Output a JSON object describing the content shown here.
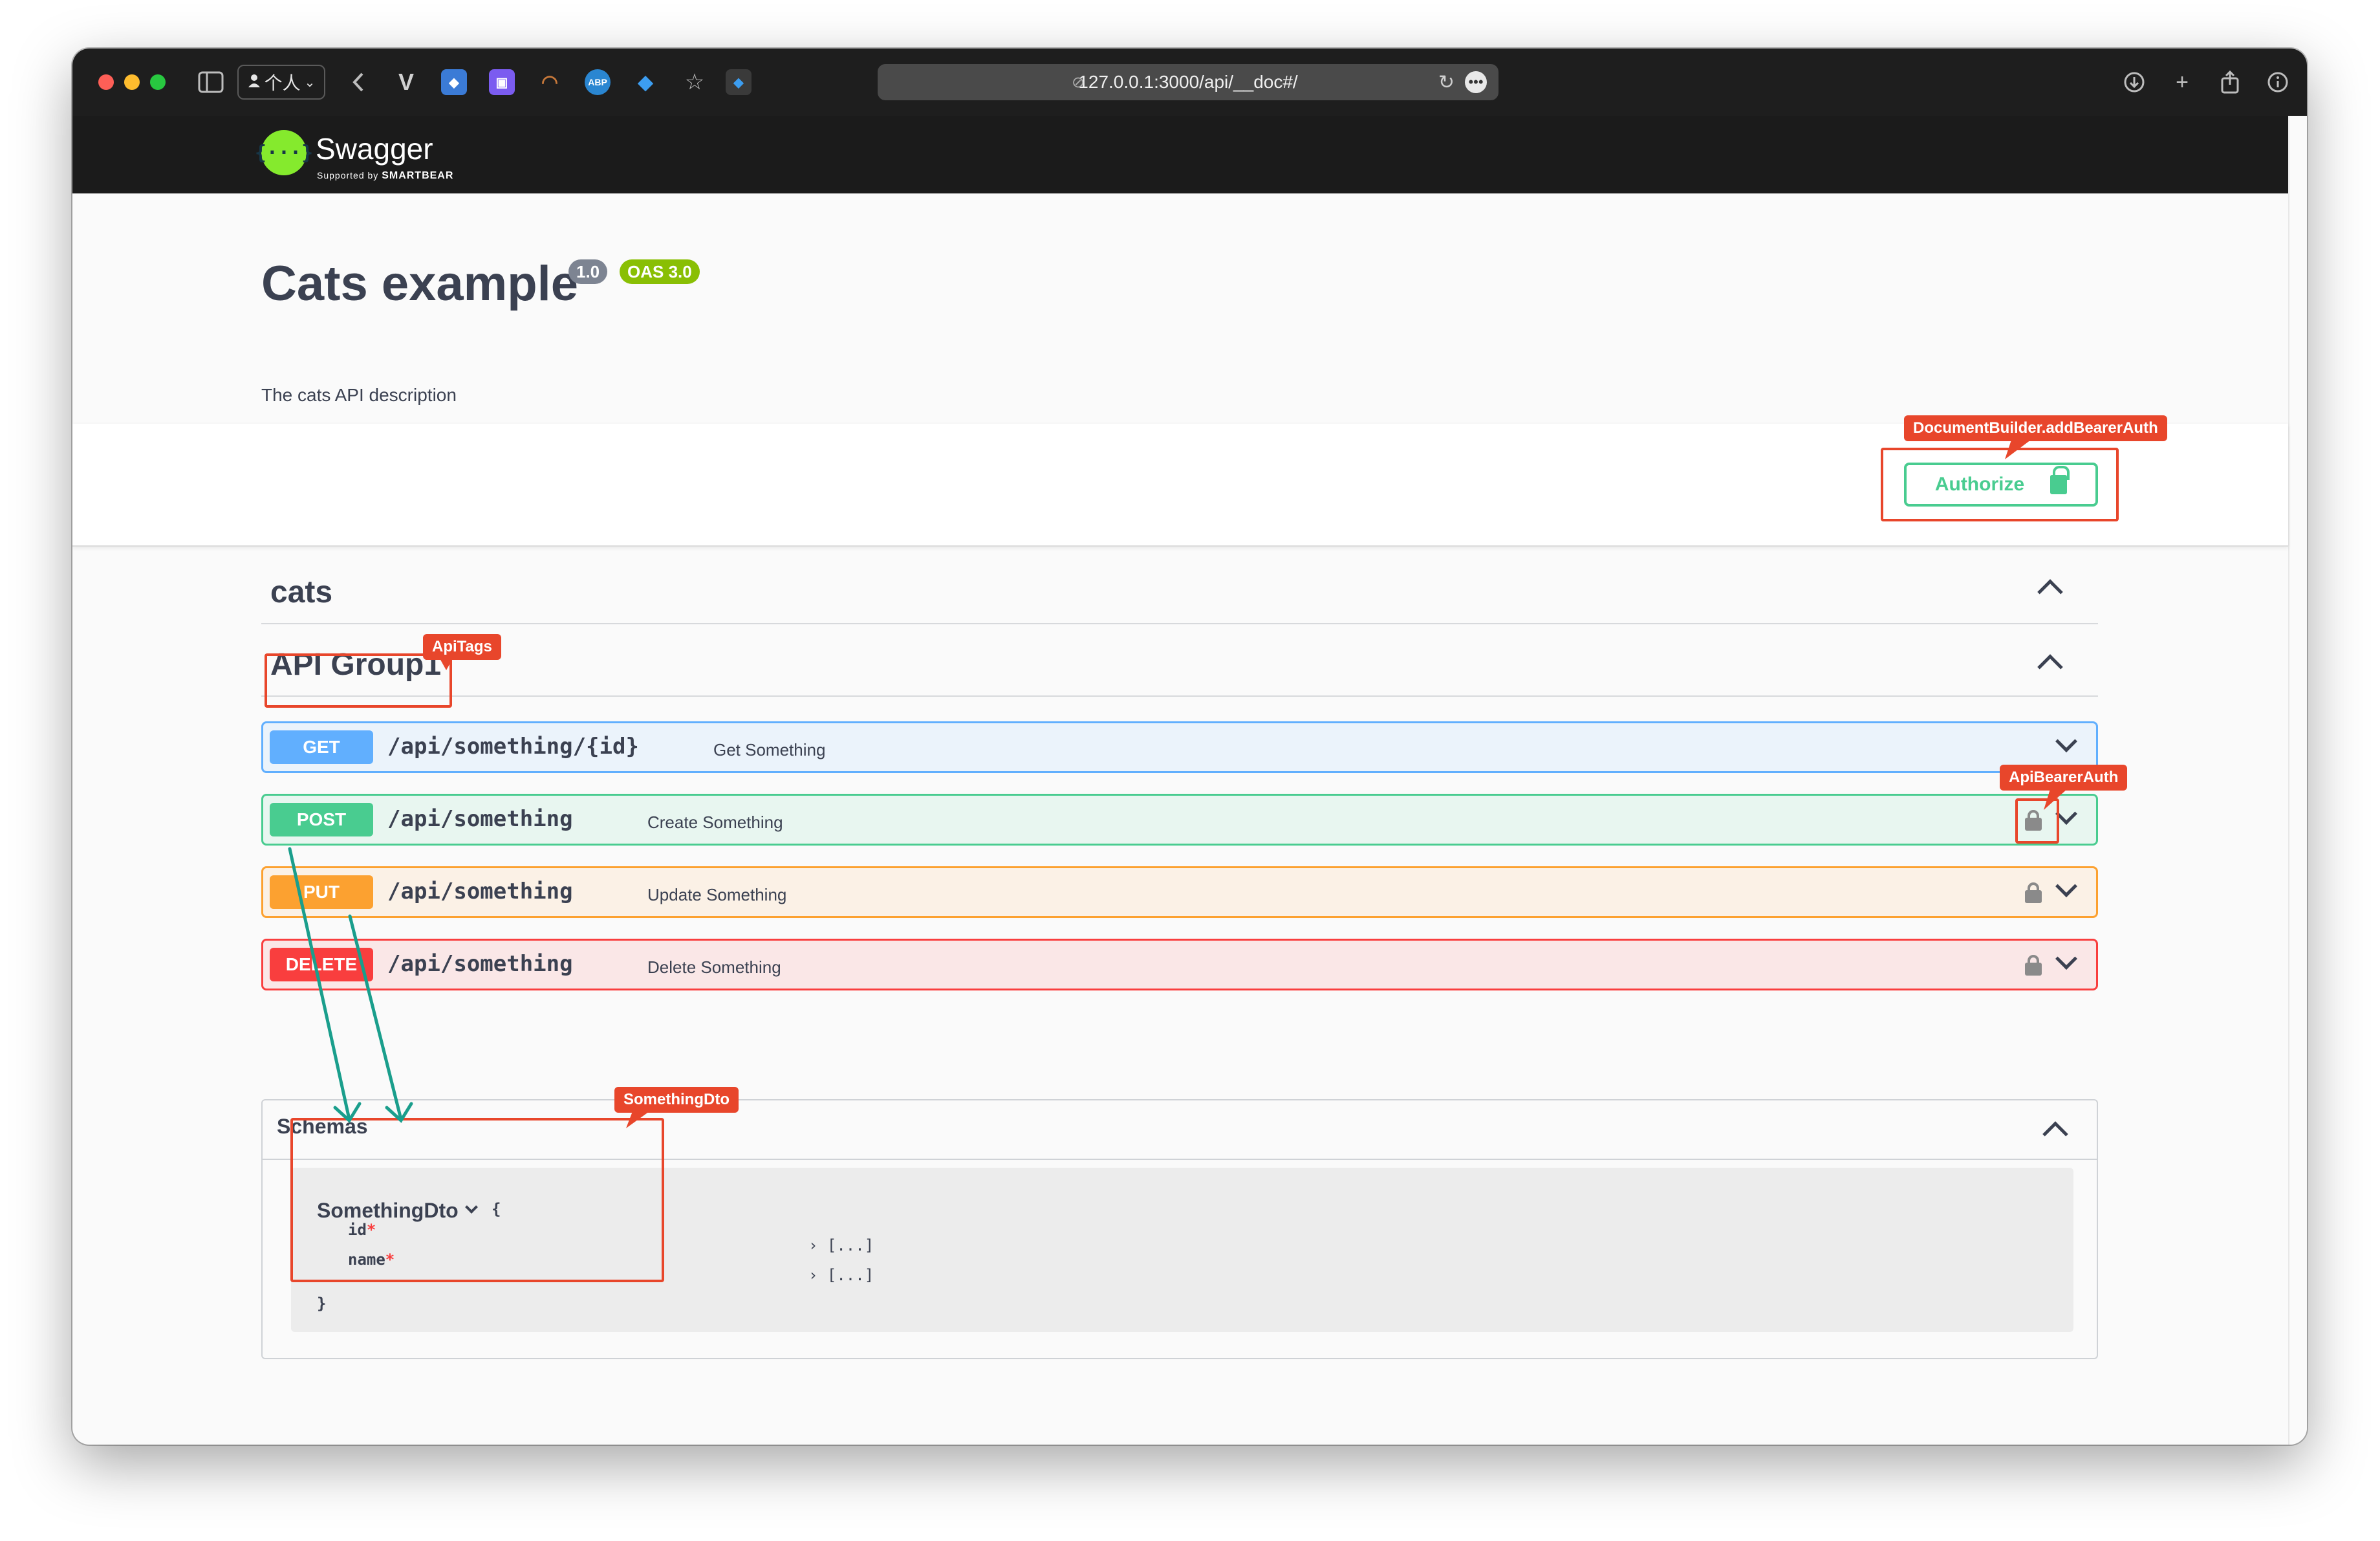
{
  "browser": {
    "profile_label": "个人",
    "url": "127.0.0.1:3000/api/__doc#/",
    "colors": {
      "toolbar": "#1e1e1e",
      "url_bar": "#4a4a4a"
    }
  },
  "swagger": {
    "logo_text": "Swagger",
    "logo_sub_prefix": "Supported by",
    "logo_sub_brand": "SMARTBEAR",
    "logo_glyph": "{···}",
    "title": "Cats example",
    "version": "1.0",
    "oas": "OAS 3.0",
    "description": "The cats API description",
    "authorize_label": "Authorize",
    "tags": [
      {
        "name": "cats"
      },
      {
        "name": "API Group1"
      }
    ],
    "operations": [
      {
        "method": "GET",
        "path": "/api/something/{id}",
        "summary": "Get Something",
        "locked": false
      },
      {
        "method": "POST",
        "path": "/api/something",
        "summary": "Create Something",
        "locked": true
      },
      {
        "method": "PUT",
        "path": "/api/something",
        "summary": "Update Something",
        "locked": true
      },
      {
        "method": "DELETE",
        "path": "/api/something",
        "summary": "Delete Something",
        "locked": true
      }
    ],
    "schemas": {
      "title": "Schemas",
      "model_name": "SomethingDto",
      "open_brace": "{",
      "close_brace": "}",
      "fields": [
        {
          "name": "id",
          "required": "*",
          "value": "[...]"
        },
        {
          "name": "name",
          "required": "*",
          "value": "[...]"
        }
      ]
    },
    "colors": {
      "get": "#61affe",
      "post": "#49cc90",
      "put": "#fca130",
      "delete": "#f93e3e",
      "oas_badge": "#89bf04",
      "version_badge": "#7d8492"
    }
  },
  "annotations": {
    "authorize": "DocumentBuilder.addBearerAuth",
    "tags": "ApiTags",
    "bearer": "ApiBearerAuth",
    "dto": "SomethingDto",
    "colors": {
      "box": "#e8462b",
      "arrow": "#1a9e8c"
    }
  }
}
